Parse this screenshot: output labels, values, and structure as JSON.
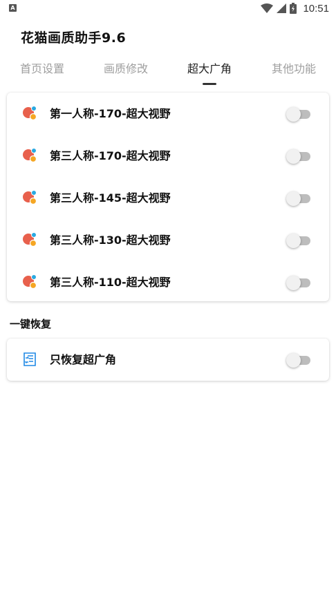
{
  "status_bar": {
    "left_icon_glyph": "A",
    "time": "10:51",
    "icons": [
      "notification-icon",
      "wifi-icon",
      "signal-icon",
      "battery-icon"
    ]
  },
  "app": {
    "title": "花猫画质助手9.6"
  },
  "tabs": [
    {
      "label": "首页设置",
      "active": false
    },
    {
      "label": "画质修改",
      "active": false
    },
    {
      "label": "超大广角",
      "active": true
    },
    {
      "label": "其他功能",
      "active": false
    }
  ],
  "wide_angle_options": [
    {
      "label": "第一人称-170-超大视野",
      "icon": "paint-palette-icon",
      "enabled": false
    },
    {
      "label": "第三人称-170-超大视野",
      "icon": "paint-palette-icon",
      "enabled": false
    },
    {
      "label": "第三人称-145-超大视野",
      "icon": "paint-palette-icon",
      "enabled": false
    },
    {
      "label": "第三人称-130-超大视野",
      "icon": "paint-palette-icon",
      "enabled": false
    },
    {
      "label": "第三人称-110-超大视野",
      "icon": "paint-palette-icon",
      "enabled": false
    }
  ],
  "restore_section": {
    "title": "一键恢复",
    "options": [
      {
        "label": "只恢复超广角",
        "icon": "restore-list-icon",
        "enabled": false
      }
    ]
  },
  "colors": {
    "palette_red": "#e8604c",
    "palette_orange": "#f5a623",
    "palette_blue": "#29a9e1",
    "restore_icon_blue": "#1e88e5",
    "switch_track_off": "#bdbdbd",
    "switch_thumb_off": "#f1f1f1"
  }
}
